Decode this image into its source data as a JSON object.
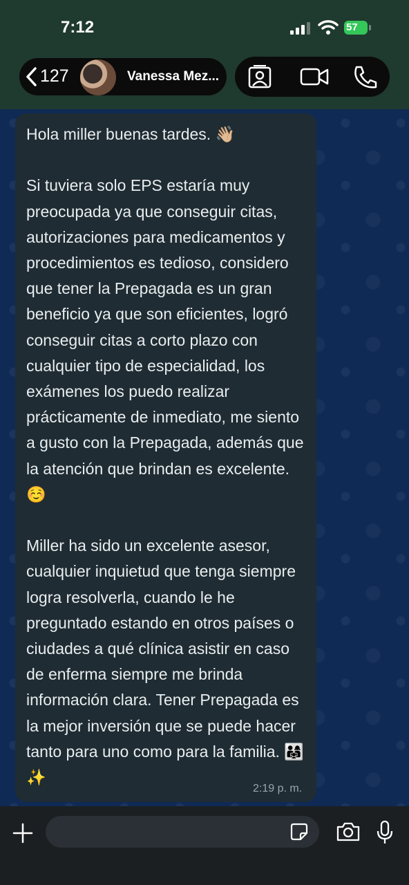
{
  "status_bar": {
    "time": "7:12",
    "battery": "57"
  },
  "header": {
    "back_count": "127",
    "contact_name": "Vanessa Mez..."
  },
  "message": {
    "text": "Hola miller buenas tardes. 👋🏼\n\nSi tuviera solo EPS estaría muy preocupada ya que conseguir citas, autorizaciones para medicamentos y procedimientos es tedioso, considero que tener la Prepagada es un gran beneficio ya que son eficientes, logró conseguir citas a corto plazo con cualquier tipo de especialidad, los exámenes los puedo realizar prácticamente de inmediato, me siento a gusto con la Prepagada, además que la atención que brindan es excelente.  ☺️\n\nMiller ha sido un excelente asesor, cualquier inquietud que tenga siempre logra resolverla, cuando le he preguntado estando en otros países o ciudades a qué clínica asistir en caso de enferma siempre me brinda información clara. Tener Prepagada es la mejor inversión que se puede hacer tanto para uno como para la familia. 👨‍👩‍👧✨",
    "time": "2:19 p. m."
  },
  "composer": {
    "input_value": ""
  },
  "colors": {
    "header_bg": "#1f3a2f",
    "chat_bg": "#0f2a55",
    "bubble_bg": "#1f2c33",
    "battery_green": "#34c759"
  },
  "icons": {
    "back": "chevron-left-icon",
    "contact_card": "contact-card-icon",
    "video": "video-camera-icon",
    "phone": "phone-icon",
    "add": "plus-icon",
    "sticker": "sticker-icon",
    "camera": "camera-icon",
    "mic": "microphone-icon"
  }
}
